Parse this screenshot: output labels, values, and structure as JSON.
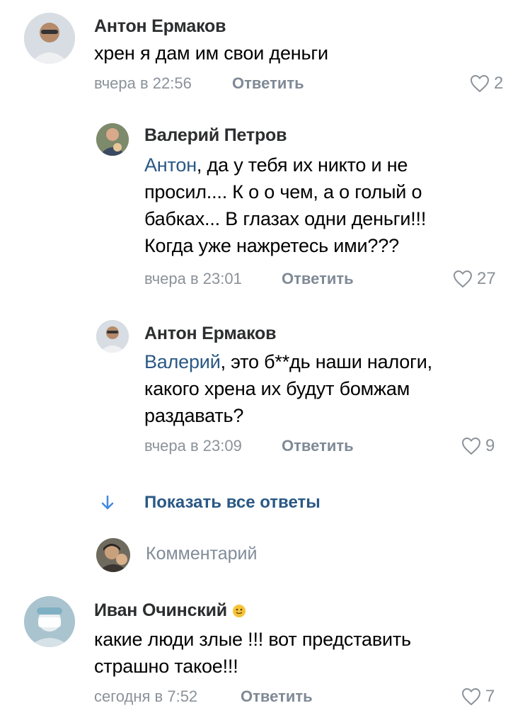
{
  "comments": [
    {
      "author": "Антон Ермаков",
      "lines": [
        "хрен я дам им свои деньги"
      ],
      "time": "вчера в 22:56",
      "reply_label": "Ответить",
      "likes": "2"
    },
    {
      "author": "Валерий Петров",
      "mention": "Антон",
      "lines": [
        ", да у тебя их никто и не",
        "просил.... К о о чем, а о голый о",
        "бабках... В глазах одни деньги!!!",
        "Когда уже нажретесь ими???"
      ],
      "time": "вчера в 23:01",
      "reply_label": "Ответить",
      "likes": "27"
    },
    {
      "author": "Антон Ермаков",
      "mention": "Валерий",
      "lines": [
        ", это б**дь наши налоги,",
        "какого хрена их будут бомжам",
        "раздавать?"
      ],
      "time": "вчера в 23:09",
      "reply_label": "Ответить",
      "likes": "9"
    },
    {
      "author": "Иван Очинский",
      "lines": [
        "какие люди злые !!! вот представить",
        "страшно такое!!!"
      ],
      "time": "сегодня в 7:52",
      "reply_label": "Ответить",
      "likes": "7"
    }
  ],
  "show_all_label": "Показать все ответы",
  "comment_input": {
    "placeholder": "Комментарий"
  },
  "colors": {
    "link": "#2a5885",
    "meta": "#8b9299",
    "name": "#2c2d2e"
  },
  "icons": [
    "heart-icon",
    "arrow-down-icon",
    "emoji-icon"
  ]
}
